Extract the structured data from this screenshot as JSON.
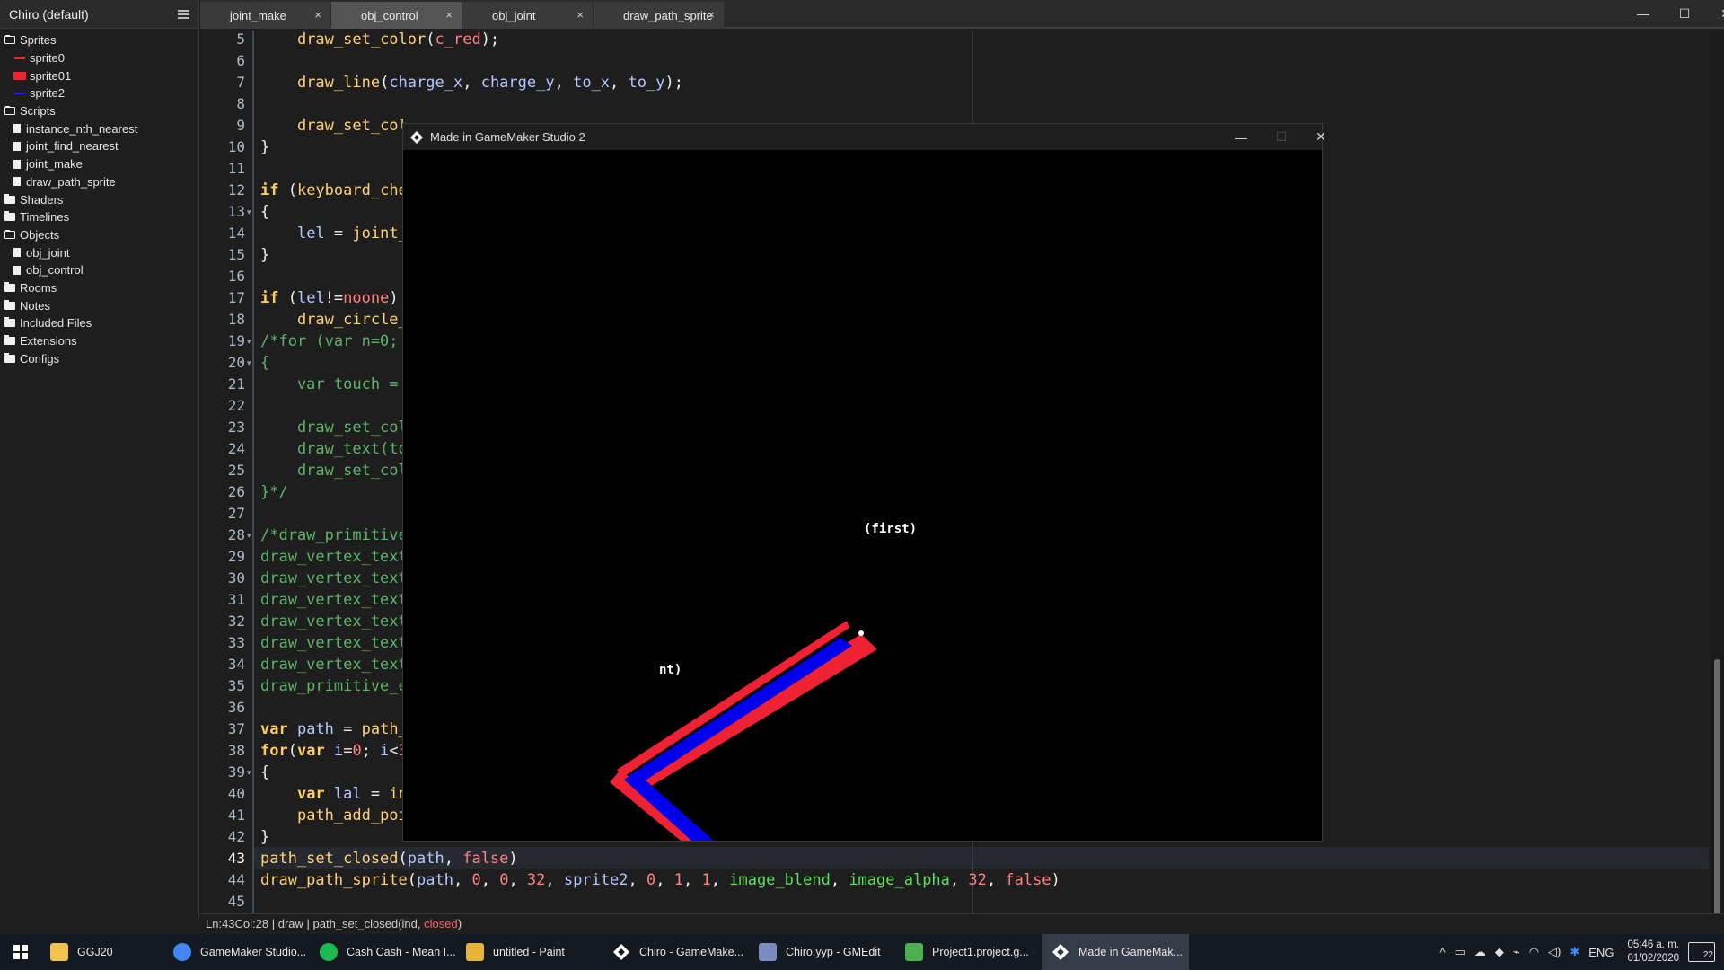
{
  "project": {
    "title": "Chiro (default)"
  },
  "tree": {
    "sprites": {
      "label": "Sprites",
      "items": [
        "sprite0",
        "sprite01",
        "sprite2"
      ]
    },
    "scripts": {
      "label": "Scripts",
      "items": [
        "instance_nth_nearest",
        "joint_find_nearest",
        "joint_make",
        "draw_path_sprite"
      ]
    },
    "shaders": "Shaders",
    "timelines": "Timelines",
    "objects": {
      "label": "Objects",
      "items": [
        "obj_joint",
        "obj_control"
      ]
    },
    "rooms": "Rooms",
    "notes": "Notes",
    "included_files": "Included Files",
    "extensions": "Extensions",
    "configs": "Configs"
  },
  "tabs": [
    {
      "label": "joint_make",
      "active": false
    },
    {
      "label": "obj_control",
      "active": true
    },
    {
      "label": "obj_joint",
      "active": false
    },
    {
      "label": "draw_path_sprite",
      "active": false
    }
  ],
  "tab_close": "×",
  "window_controls": {
    "minimize": "—",
    "maximize": "☐",
    "close": "✕"
  },
  "editor": {
    "line_numbers": [
      "5",
      "6",
      "7",
      "8",
      "9",
      "10",
      "11",
      "12",
      "13",
      "14",
      "15",
      "16",
      "17",
      "18",
      "19",
      "20",
      "21",
      "22",
      "23",
      "24",
      "25",
      "26",
      "27",
      "28",
      "29",
      "30",
      "31",
      "32",
      "33",
      "34",
      "35",
      "36",
      "37",
      "38",
      "39",
      "40",
      "41",
      "42",
      "43",
      "44",
      "45"
    ],
    "fold_lines": [
      "13",
      "19",
      "20",
      "28",
      "39"
    ],
    "current_line": "43"
  },
  "status": {
    "ln_label": "Ln:",
    "ln": "43",
    "col_label": "Col:",
    "col": "28",
    "context": "draw | path_set_closed(ind, ",
    "param": "closed",
    "close": ")"
  },
  "game_window": {
    "title": "Made in GameMaker Studio 2",
    "label_first": "(first)",
    "label_joint": "nt)"
  },
  "taskbar": {
    "items": [
      {
        "label": "GGJ20",
        "icon": "folder-icon",
        "color": "#f2c14e"
      },
      {
        "label": "GameMaker Studio...",
        "icon": "chrome-icon",
        "color": "#4285f4"
      },
      {
        "label": "Cash Cash - Mean I...",
        "icon": "spotify-icon",
        "color": "#1db954"
      },
      {
        "label": "untitled - Paint",
        "icon": "paint-icon",
        "color": "#e8b339"
      },
      {
        "label": "Chiro - GameMake...",
        "icon": "gamemaker-icon",
        "color": "#ffffff"
      },
      {
        "label": "Chiro.yyp - GMEdit",
        "icon": "gmedit-icon",
        "color": "#7a8cc4"
      },
      {
        "label": "Project1.project.g...",
        "icon": "project-icon",
        "color": "#4caf50"
      },
      {
        "label": "Made in GameMak...",
        "icon": "gamemaker-icon",
        "color": "#ffffff",
        "active": true
      }
    ],
    "lang": "ENG",
    "time": "05:46 a. m.",
    "date": "01/02/2020",
    "notifications": "22"
  }
}
